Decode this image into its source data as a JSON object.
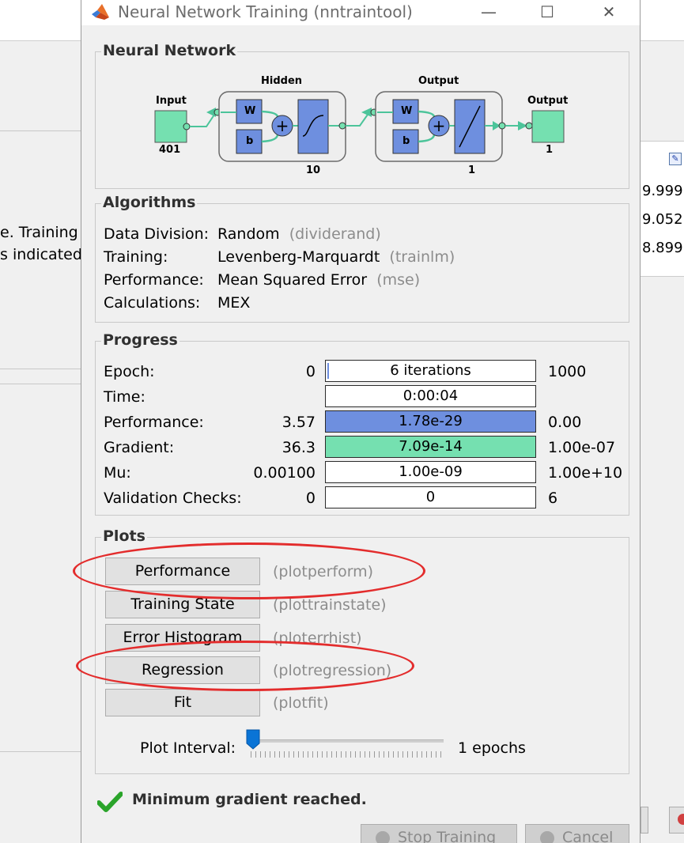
{
  "background": {
    "left_text_1": "e. Training",
    "left_text_2": "s indicated",
    "right_values": [
      "9.999",
      "9.052",
      "8.899"
    ]
  },
  "window": {
    "title": "Neural Network Training (nntraintool)",
    "controls": {
      "minimize": "—",
      "maximize": "☐",
      "close": "✕"
    }
  },
  "network": {
    "group_title": "Neural Network",
    "input_label": "Input",
    "input_size": "401",
    "hidden_label": "Hidden",
    "hidden_size": "10",
    "output_layer_label": "Output",
    "output_layer_size": "1",
    "output_label": "Output",
    "output_size": "1",
    "weight_label": "W",
    "bias_label": "b",
    "colors": {
      "layer_box": "#6e8fdf",
      "io_box": "#75e0b0",
      "line": "#4cc49a"
    }
  },
  "algorithms": {
    "group_title": "Algorithms",
    "rows": [
      {
        "label": "Data Division:",
        "value": "Random",
        "fn": "(dividerand)"
      },
      {
        "label": "Training:",
        "value": "Levenberg-Marquardt",
        "fn": "(trainlm)"
      },
      {
        "label": "Performance:",
        "value": "Mean Squared Error",
        "fn": "(mse)"
      },
      {
        "label": "Calculations:",
        "value": "MEX",
        "fn": ""
      }
    ]
  },
  "progress": {
    "group_title": "Progress",
    "rows": [
      {
        "label": "Epoch:",
        "start": "0",
        "current": "6 iterations",
        "target": "1000",
        "fill": 0.006
      },
      {
        "label": "Time:",
        "start": "",
        "current": "0:00:04",
        "target": "",
        "fill": 0
      },
      {
        "label": "Performance:",
        "start": "3.57",
        "current": "1.78e-29",
        "target": "0.00",
        "fill": 1
      },
      {
        "label": "Gradient:",
        "start": "36.3",
        "current": "7.09e-14",
        "target": "1.00e-07",
        "fill": 1
      },
      {
        "label": "Mu:",
        "start": "0.00100",
        "current": "1.00e-09",
        "target": "1.00e+10",
        "fill": 0
      },
      {
        "label": "Validation Checks:",
        "start": "0",
        "current": "0",
        "target": "6",
        "fill": 0
      }
    ]
  },
  "plots": {
    "group_title": "Plots",
    "buttons": [
      {
        "label": "Performance",
        "fn": "(plotperform)"
      },
      {
        "label": "Training State",
        "fn": "(plottrainstate)"
      },
      {
        "label": "Error Histogram",
        "fn": "(ploterrhist)"
      },
      {
        "label": "Regression",
        "fn": "(plotregression)"
      },
      {
        "label": "Fit",
        "fn": "(plotfit)"
      }
    ],
    "interval_label": "Plot Interval:",
    "interval_value": "1 epochs",
    "annotation_color": "#e32c2c"
  },
  "status": {
    "message": "Minimum gradient reached."
  },
  "footer": {
    "stop_label": "Stop Training",
    "cancel_label": "Cancel"
  }
}
